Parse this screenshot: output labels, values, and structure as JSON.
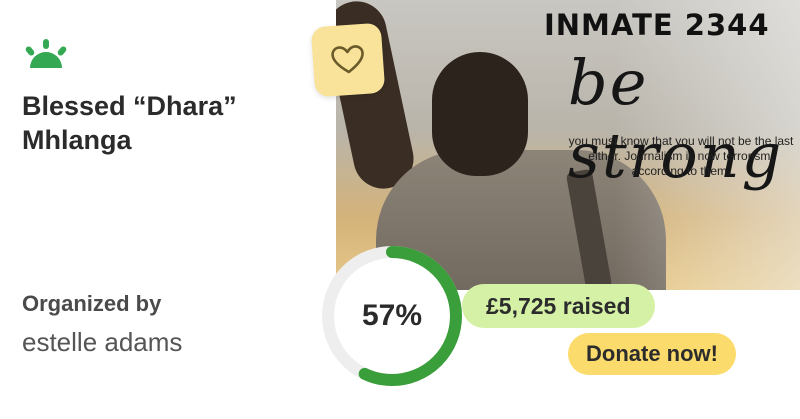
{
  "brand": {
    "logo_icon": "gofundme-sprout-icon",
    "color": "#34a853"
  },
  "campaign": {
    "title": "Blessed “Dhara” Mhlanga",
    "organizer_label": "Organized by",
    "organizer_name": "estelle adams"
  },
  "hero_image": {
    "headline": "INMATE 2344",
    "script_text": "be strong",
    "caption": "you must know that you will not be the last either. Journalism is now terrorism, according to them."
  },
  "heart_button": {
    "icon": "heart-icon",
    "color": "#f9e39a"
  },
  "progress": {
    "percent_label": "57%",
    "fraction": 0.57,
    "ring_color": "#3a9e3a",
    "track_color": "#eeeeee"
  },
  "raised": {
    "label": "£5,725 raised",
    "color": "#d5f1a6"
  },
  "donate": {
    "label": "Donate now!",
    "color": "#fbdb6b"
  }
}
